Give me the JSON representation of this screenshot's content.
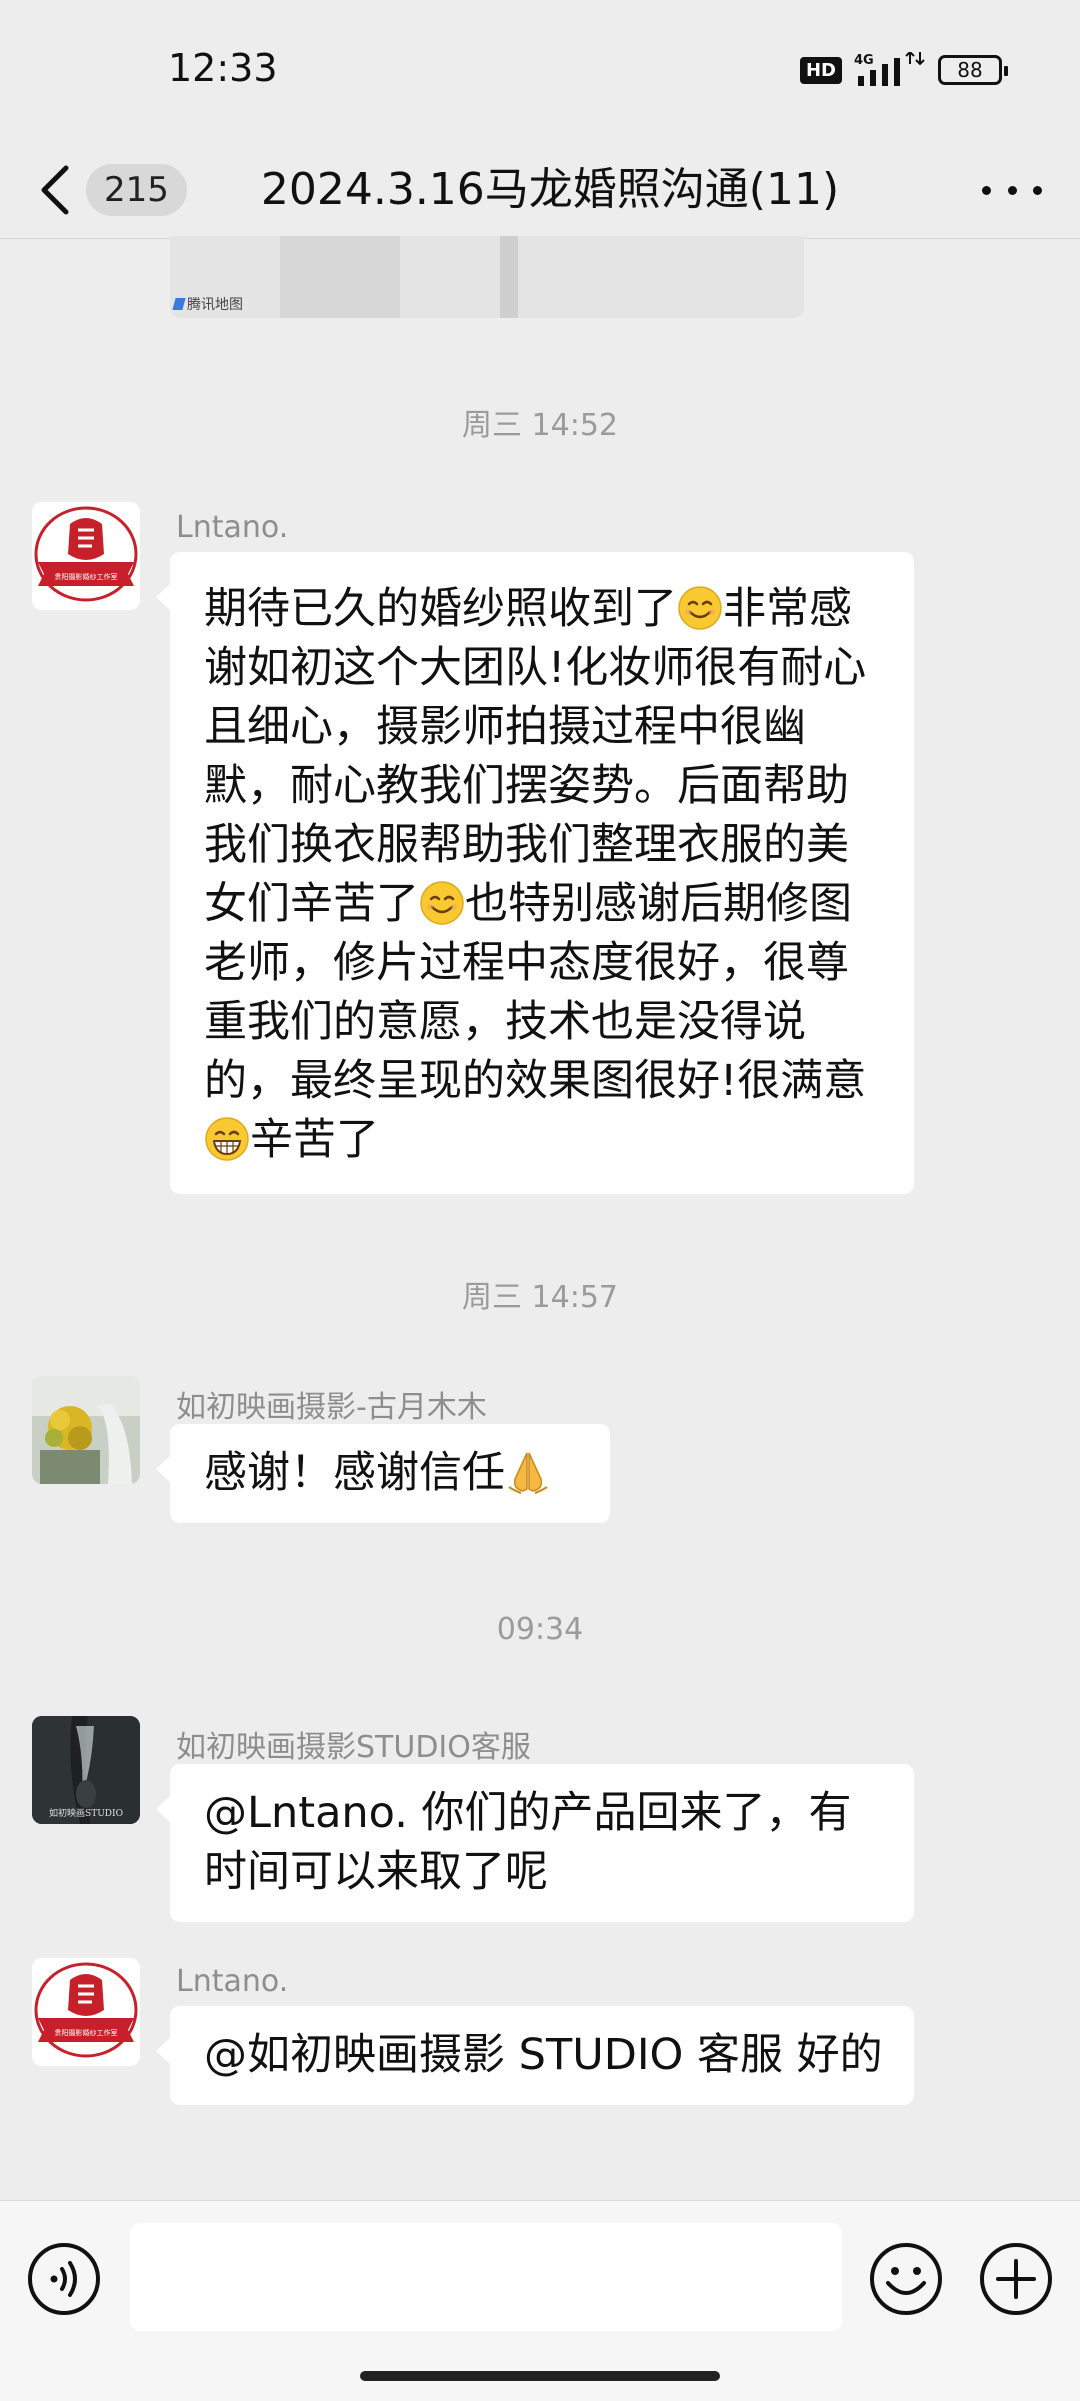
{
  "status_bar": {
    "time": "12:33",
    "hd": "HD",
    "network": "4G",
    "battery": "88"
  },
  "nav": {
    "unread_count": "215",
    "title": "2024.3.16马龙婚照沟通(11)"
  },
  "map_card": {
    "credit": "腾讯地图"
  },
  "messages": [
    {
      "timestamp": "周三 14:52"
    },
    {
      "sender": "Lntano.",
      "text_parts": [
        "期待已久的婚纱照收到了",
        "非常感谢如初这个大团队!化妆师很有耐心且细心，摄影师拍摄过程中很幽默，耐心教我们摆姿势。后面帮助我们换衣服帮助我们整理衣服的美女们辛苦了",
        "也特别感谢后期修图老师，修片过程中态度很好，很尊重我们的意愿，技术也是没得说的，最终呈现的效果图很好!很满意",
        "辛苦了"
      ],
      "emojis": [
        "smiling-face",
        "smiling-face",
        "grinning-face"
      ]
    },
    {
      "timestamp": "周三 14:57"
    },
    {
      "sender": "如初映画摄影-古月木木",
      "text": "感谢！感谢信任",
      "emoji": "folded-hands"
    },
    {
      "timestamp": "09:34"
    },
    {
      "sender": "如初映画摄影STUDIO客服",
      "text": "@Lntano. 你们的产品回来了，有时间可以来取了呢"
    },
    {
      "sender": "Lntano.",
      "text": "@如初映画摄影 STUDIO 客服  好的"
    }
  ],
  "avatars": {
    "lntano_caption": "贵阳摄影婚纱工作室",
    "studio_caption": "如初映画STUDIO"
  },
  "input_bar": {
    "placeholder": ""
  },
  "colors": {
    "background": "#ededed",
    "bubble": "#ffffff",
    "timestamp": "#9b9b9b",
    "sender": "#8e8e8e",
    "logo_red": "#c8202a"
  }
}
